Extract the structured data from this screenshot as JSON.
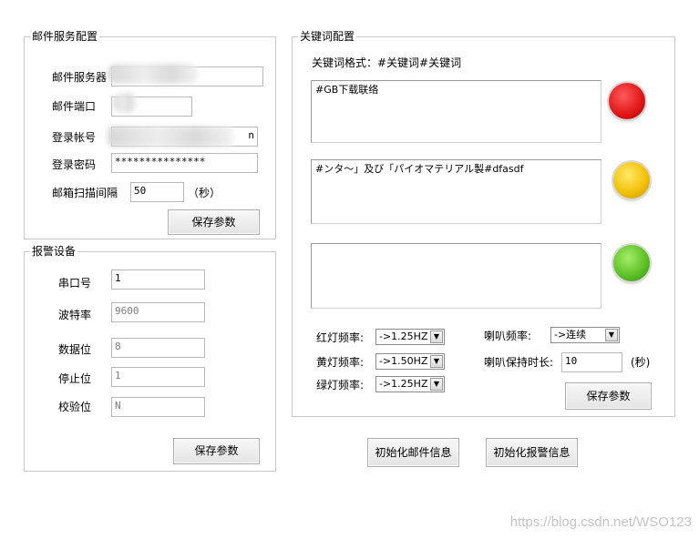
{
  "mail_config": {
    "title": "邮件服务配置",
    "server_label": "邮件服务器",
    "port_label": "邮件端口",
    "account_label": "登录帐号",
    "account_tail": "n",
    "password_label": "登录密码",
    "password_value": "***************",
    "interval_label": "邮箱扫描间隔",
    "interval_value": "50",
    "interval_unit": "（秒）",
    "save_label": "保存参数"
  },
  "alarm_device": {
    "title": "报警设备",
    "serial_label": "串口号",
    "serial_value": "1",
    "baud_label": "波特率",
    "baud_value": "9600",
    "databits_label": "数据位",
    "databits_value": "8",
    "stopbits_label": "停止位",
    "stopbits_value": "1",
    "parity_label": "校验位",
    "parity_value": "N",
    "save_label": "保存参数"
  },
  "keyword_config": {
    "title": "关键词配置",
    "format_hint": "关键词格式：#关键词#关键词",
    "red_keywords": "#GB下载联络",
    "yellow_keywords": "#ンタ〜」及び「パイオマテリアル製#dfasdf",
    "green_keywords": "",
    "red_freq_label": "红灯频率:",
    "red_freq_value": "->1.25HZ",
    "yellow_freq_label": "黄灯频率:",
    "yellow_freq_value": "->1.50HZ",
    "green_freq_label": "绿灯频率:",
    "green_freq_value": "->1.25HZ",
    "horn_freq_label": "喇叭频率:",
    "horn_freq_value": "->连续",
    "horn_duration_label": "喇叭保持时长:",
    "horn_duration_value": "10",
    "horn_duration_unit": "(秒)",
    "save_label": "保存参数"
  },
  "actions": {
    "init_mail_label": "初始化邮件信息",
    "init_alarm_label": "初始化报警信息"
  },
  "watermark": "https://blog.csdn.net/WSO123",
  "colors": {
    "red_lamp": "#e21a1a",
    "yellow_lamp": "#f2c20a",
    "green_lamp": "#5fc227"
  },
  "icons": {
    "dropdown": "chevron-down-icon"
  }
}
